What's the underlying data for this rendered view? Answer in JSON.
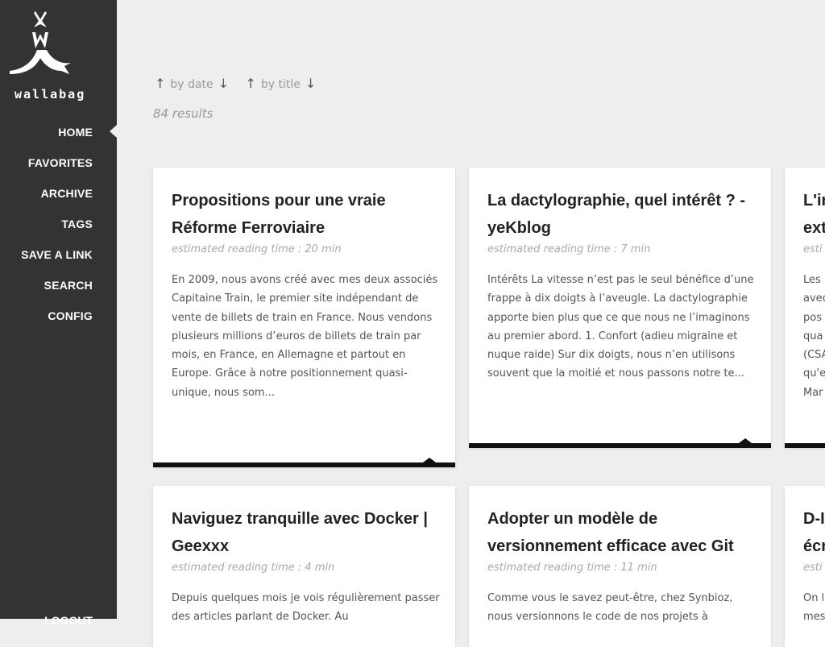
{
  "brand": {
    "name": "wallabag"
  },
  "nav": {
    "items": [
      {
        "label": "HOME",
        "active": true
      },
      {
        "label": "FAVORITES"
      },
      {
        "label": "ARCHIVE"
      },
      {
        "label": "TAGS"
      },
      {
        "label": "SAVE A LINK"
      },
      {
        "label": "SEARCH"
      },
      {
        "label": "CONFIG"
      }
    ],
    "logout": "LOGOUT"
  },
  "sort": {
    "by_date": "by date",
    "by_title": "by title",
    "up_arrow": "↑",
    "down_arrow": "↓"
  },
  "results": "84 results",
  "cards": [
    {
      "title": "Propositions pour une vraie Réforme Ferroviaire",
      "meta": "estimated reading time : 20 min",
      "summary": "En 2009, nous avons créé avec mes deux associés Capitaine Train, le premier site indépendant de vente de billets de train en France. Nous vendons plusieurs millions d’euros de billets de train par mois, en France, en Allemagne et partout en Europe. Grâce à notre positionnement quasi-unique, nous som..."
    },
    {
      "title": "La dactylographie, quel intérêt ? - yeKblog",
      "meta": "estimated reading time : 7 min",
      "summary": "Intérêts La vitesse n’est pas le seul bénéfice d’une frappe à dix doigts à l’aveugle. La dactylographie apporte bien plus que ce que nous ne l’imaginons au premier abord. 1. Confort (adieu migraine et nuque raide) Sur dix doigts, nous n’en utilisons souvent que la moitié et nous passons notre te..."
    },
    {
      "title": "L'in ext",
      "meta": "esti",
      "summary": "Les avec pos qua (CSA qu'e Mar"
    },
    {
      "title": "Naviguez tranquille avec Docker | Geexxx",
      "meta": "estimated reading time : 4 min",
      "summary": "Depuis quelques mois je vois régulièrement passer des articles parlant de Docker. Au"
    },
    {
      "title": "Adopter un modèle de versionnement efficace avec Git",
      "meta": "estimated reading time : 11 min",
      "summary": "Comme vous le savez peut-être, chez Synbioz, nous versionnons le code de nos projets à"
    },
    {
      "title": "D-I écr",
      "meta": "esti",
      "summary": "On l mes"
    }
  ]
}
